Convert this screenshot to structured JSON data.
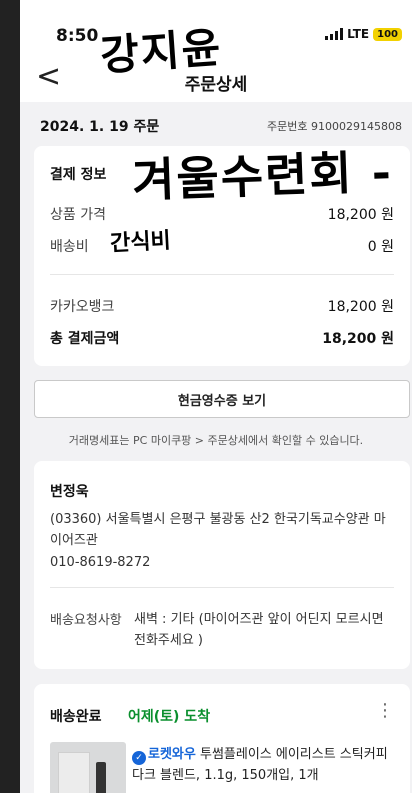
{
  "status": {
    "time": "8:50",
    "network": "LTE",
    "battery": "100"
  },
  "header": {
    "title": "주문상세",
    "back_label": "<"
  },
  "order": {
    "date": "2024. 1. 19 주문",
    "number": "주문번호 9100029145808"
  },
  "payment": {
    "title": "결제 정보",
    "product_label": "상품 가격",
    "product_value": "18,200 원",
    "shipping_label": "배송비",
    "shipping_value": "0 원",
    "method_label": "카카오뱅크",
    "method_value": "18,200 원",
    "total_label": "총 결제금액",
    "total_value": "18,200 원"
  },
  "receipt": {
    "button": "현금영수증 보기",
    "note": "거래명세표는 PC 마이쿠팡 > 주문상세에서 확인할 수 있습니다."
  },
  "address": {
    "name": "변정욱",
    "text": "(03360) 서울특별시 은평구 불광동 산2 한국기독교수양관 마이어즈관",
    "phone": "010-8619-8272",
    "request_label": "배송요청사항",
    "request_text": "새벽 : 기타 (마이어즈관 앞이 어딘지 모르시면 전화주세요 )"
  },
  "shipping": {
    "status": "배송완료",
    "arrival": "어제(토) 도착",
    "more_icon": "⋮",
    "rocket_label": "로켓와우",
    "product_name": "투썸플레이스 에이리스트 스틱커피 다크 블렌드, 1.1g, 150개입, 1개"
  },
  "handwriting": {
    "name": "강지윤",
    "event": "겨울수련회 -",
    "category": "간식비"
  },
  "colors": {
    "accent_green": "#0a8f2d",
    "rocket_blue": "#1565d8",
    "battery_yellow": "#f2d100"
  }
}
